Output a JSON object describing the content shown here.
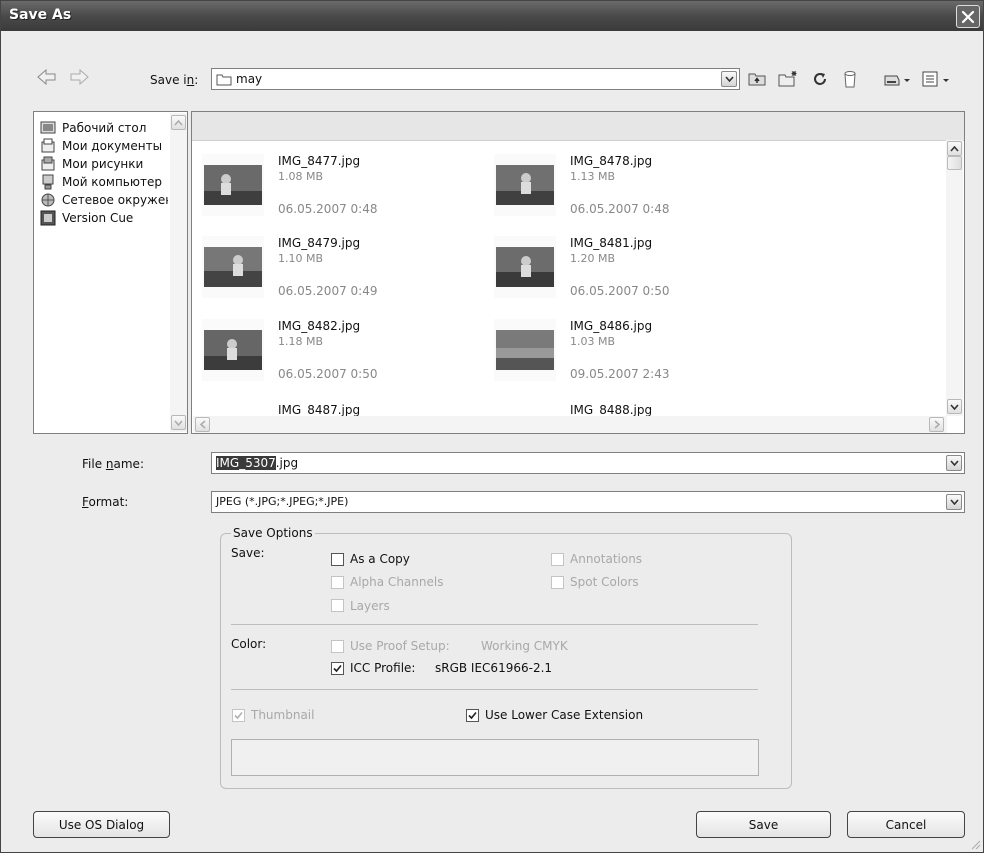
{
  "window": {
    "title": "Save As"
  },
  "toolbar": {
    "save_in_label": "Save in:",
    "save_in_value": "may"
  },
  "places": [
    {
      "label": "Рабочий стол",
      "icon": "desktop-icon"
    },
    {
      "label": "Мои документы",
      "icon": "documents-icon"
    },
    {
      "label": "Мои рисунки",
      "icon": "pictures-icon"
    },
    {
      "label": "Мой компьютер",
      "icon": "computer-icon"
    },
    {
      "label": "Сетевое окружение",
      "icon": "network-icon"
    },
    {
      "label": "Version Cue",
      "icon": "version-cue-icon"
    }
  ],
  "files": [
    {
      "name": "IMG_8477.jpg",
      "size": "1.08 MB",
      "date": "06.05.2007 0:48"
    },
    {
      "name": "IMG_8478.jpg",
      "size": "1.13 MB",
      "date": "06.05.2007 0:48"
    },
    {
      "name": "IMG_8479.jpg",
      "size": "1.10 MB",
      "date": "06.05.2007 0:49"
    },
    {
      "name": "IMG_8481.jpg",
      "size": "1.20 MB",
      "date": "06.05.2007 0:50"
    },
    {
      "name": "IMG_8482.jpg",
      "size": "1.18 MB",
      "date": "06.05.2007 0:50"
    },
    {
      "name": "IMG_8486.jpg",
      "size": "1.03 MB",
      "date": "09.05.2007 2:43"
    },
    {
      "name": "IMG_8487.jpg",
      "size": "",
      "date": ""
    },
    {
      "name": "IMG_8488.jpg",
      "size": "",
      "date": ""
    }
  ],
  "filename": {
    "label_pre": "File ",
    "label_accel": "n",
    "label_post": "ame:",
    "value_selected": "IMG_5307",
    "value_rest": ".jpg"
  },
  "format": {
    "label_accel": "F",
    "label_post": "ormat:",
    "value": "JPEG (*.JPG;*.JPEG;*.JPE)"
  },
  "options": {
    "group_title": "Save Options",
    "save_label": "Save:",
    "as_a_copy": "As a Copy",
    "alpha_channels": "Alpha Channels",
    "layers": "Layers",
    "annotations": "Annotations",
    "spot_colors": "Spot Colors",
    "color_label": "Color:",
    "use_proof_setup": "Use Proof Setup:",
    "proof_value": "Working CMYK",
    "icc_profile": "ICC Profile:",
    "icc_value": "sRGB IEC61966-2.1",
    "thumbnail": "Thumbnail",
    "lower_case_ext": "Use Lower Case Extension"
  },
  "buttons": {
    "os_dialog": "Use OS Dialog",
    "save": "Save",
    "cancel": "Cancel"
  }
}
